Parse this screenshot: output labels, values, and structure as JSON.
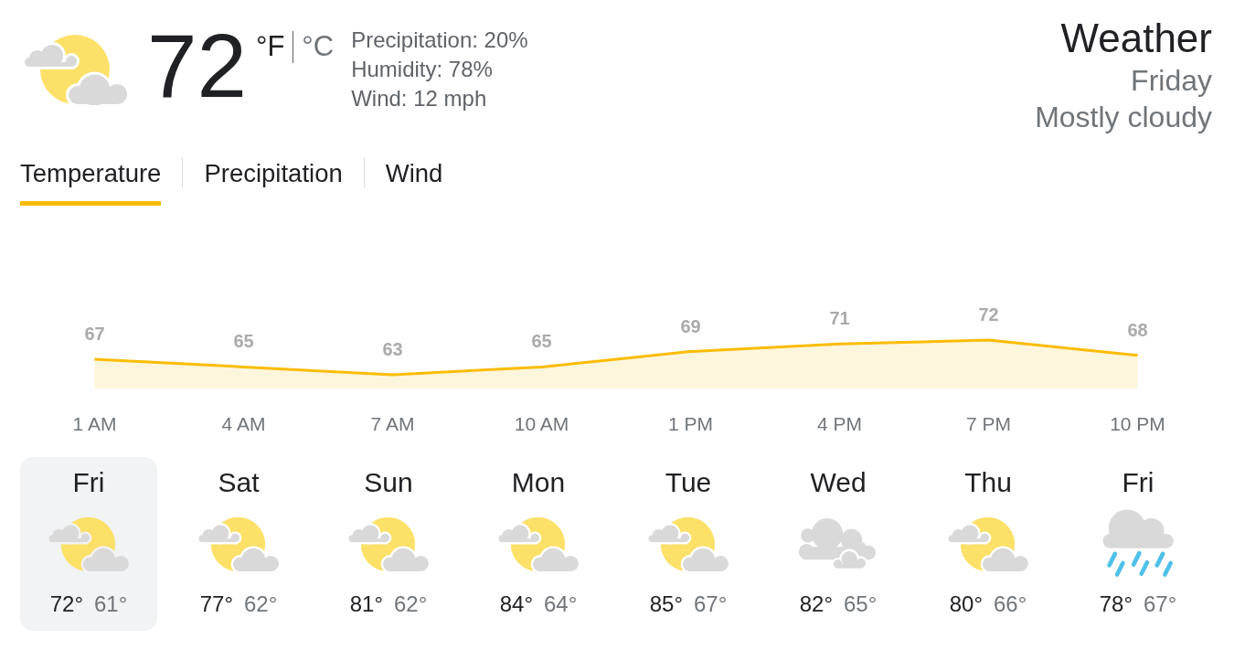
{
  "current": {
    "kind": "partlycloudy",
    "temperature": "72",
    "units": [
      {
        "label": "°F",
        "selected": true
      },
      {
        "label": "°C",
        "selected": false
      }
    ],
    "details": [
      "Precipitation: 20%",
      "Humidity: 78%",
      "Wind: 12 mph"
    ]
  },
  "summary": {
    "title": "Weather",
    "day": "Friday",
    "condition": "Mostly cloudy"
  },
  "tabs": [
    {
      "label": "Temperature",
      "selected": true
    },
    {
      "label": "Precipitation",
      "selected": false
    },
    {
      "label": "Wind",
      "selected": false
    }
  ],
  "hourly_chart": {
    "chart_data": {
      "type": "area",
      "categories": [
        "1 AM",
        "4 AM",
        "7 AM",
        "10 AM",
        "1 PM",
        "4 PM",
        "7 PM",
        "10 PM"
      ],
      "series": [
        {
          "color": "#fbbc04",
          "values": [
            67,
            65,
            63,
            65,
            69,
            71,
            72,
            68
          ]
        }
      ],
      "data_labels": true
    }
  },
  "forecast": [
    {
      "day": "Fri",
      "kind": "partlycloudy",
      "high": "72°",
      "low": "61°",
      "selected": true
    },
    {
      "day": "Sat",
      "kind": "partlycloudy",
      "high": "77°",
      "low": "62°",
      "selected": false
    },
    {
      "day": "Sun",
      "kind": "partlycloudy",
      "high": "81°",
      "low": "62°",
      "selected": false
    },
    {
      "day": "Mon",
      "kind": "partlycloudy",
      "high": "84°",
      "low": "64°",
      "selected": false
    },
    {
      "day": "Tue",
      "kind": "partlycloudy",
      "high": "85°",
      "low": "67°",
      "selected": false
    },
    {
      "day": "Wed",
      "kind": "cloudy",
      "high": "82°",
      "low": "65°",
      "selected": false
    },
    {
      "day": "Thu",
      "kind": "partlycloudy",
      "high": "80°",
      "low": "66°",
      "selected": false
    },
    {
      "day": "Fri",
      "kind": "rain",
      "high": "78°",
      "low": "67°",
      "selected": false
    }
  ]
}
